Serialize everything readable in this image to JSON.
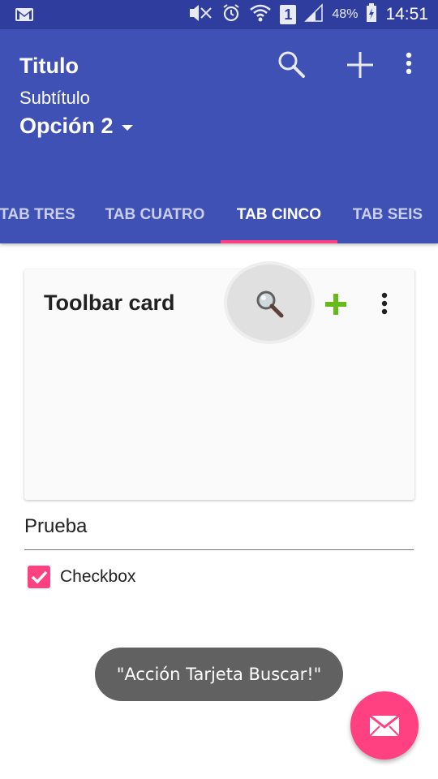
{
  "status_bar": {
    "battery_percent": "48%",
    "time": "14:51",
    "sim_label": "1",
    "icons": [
      "gmail-icon",
      "mute-icon",
      "alarm-icon",
      "wifi-icon",
      "sim-icon",
      "signal-icon",
      "battery-icon"
    ]
  },
  "appbar": {
    "title": "Titulo",
    "subtitle": "Subtítulo",
    "spinner_selected": "Opción 2",
    "actions": [
      "search-icon",
      "add-icon",
      "overflow-menu-icon"
    ],
    "color": "#3f51b5"
  },
  "tabs": {
    "items": [
      {
        "label": "TAB TRES"
      },
      {
        "label": "TAB CUATRO"
      },
      {
        "label": "TAB CINCO"
      },
      {
        "label": "TAB SEIS"
      }
    ],
    "active_index": 2,
    "indicator_color": "#ff4081"
  },
  "card": {
    "title": "Toolbar card",
    "actions": [
      "search-icon",
      "add-icon",
      "overflow-menu-icon"
    ]
  },
  "form": {
    "text_value": "Prueba",
    "checkbox_label": "Checkbox",
    "checkbox_checked": true
  },
  "toast": {
    "message": "\"Acción Tarjeta Buscar!\""
  },
  "fab": {
    "icon": "email-icon",
    "color": "#ff4081"
  }
}
